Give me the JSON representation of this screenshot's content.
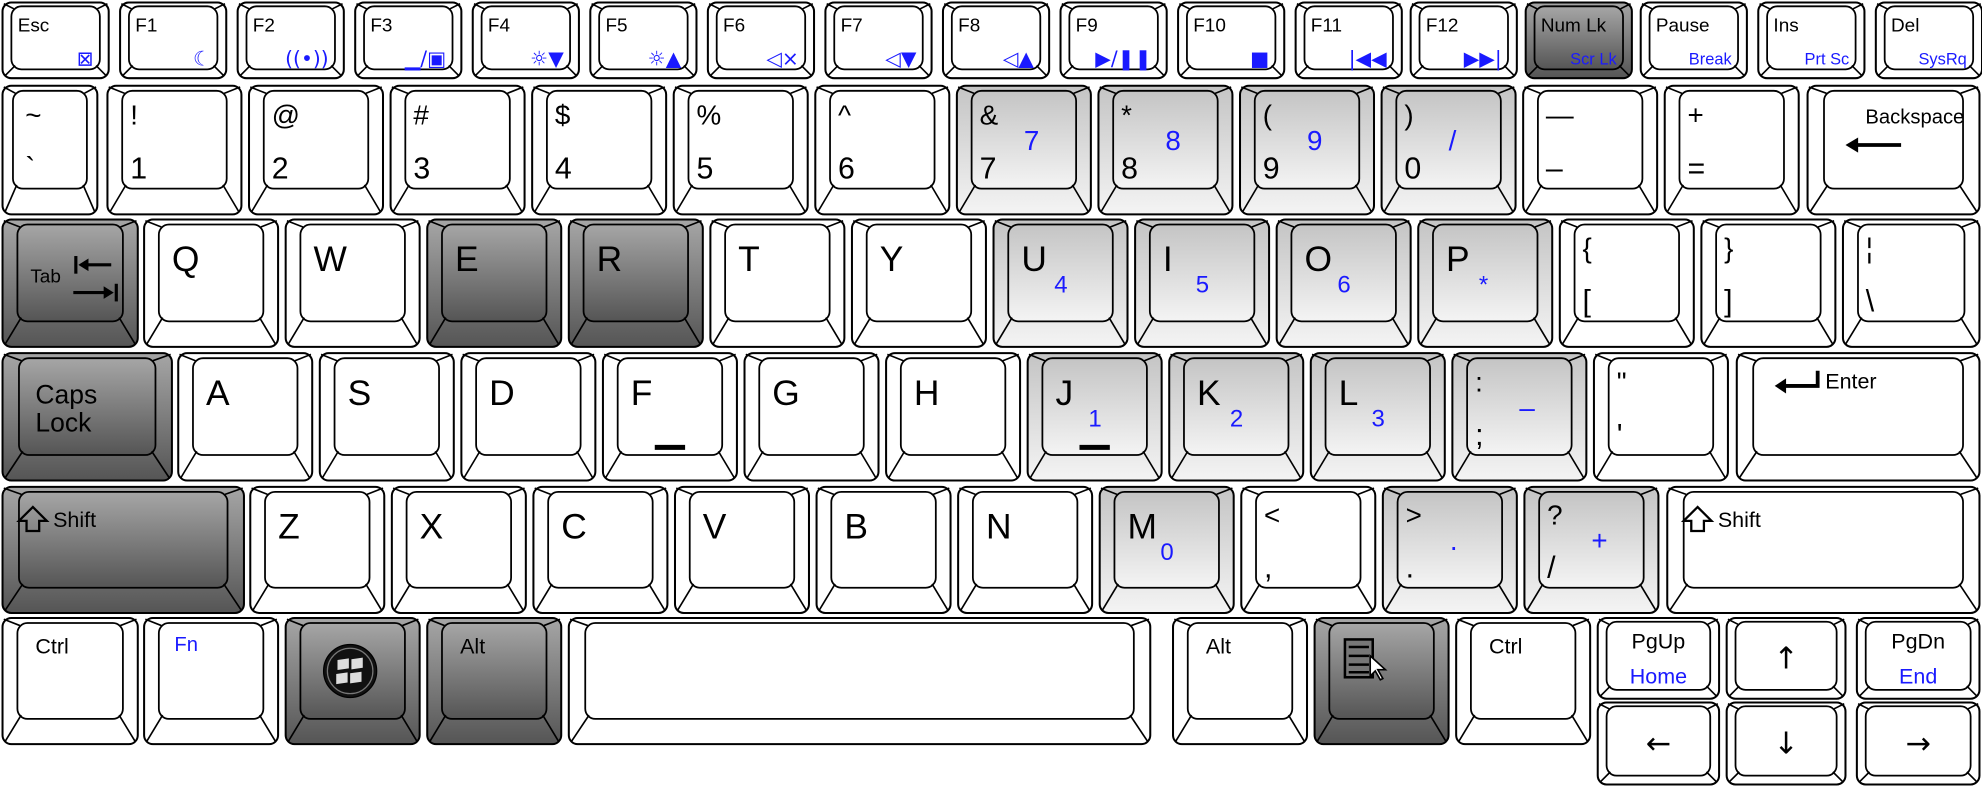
{
  "colors": {
    "blue_legend": "#1a1aff",
    "key_outline": "#000000",
    "dark_key_top": "#a6a6a6",
    "dark_key_bottom": "#555555",
    "light_key_top": "#c4c4c4",
    "light_key_bottom": "#f4f4f4",
    "white_key": "#ffffff"
  },
  "rows": [
    {
      "keys": [
        {
          "label": "Esc",
          "icon": "touchpad-off-icon"
        },
        {
          "label": "F1",
          "icon": "sleep-moon-icon"
        },
        {
          "label": "F2",
          "icon": "wireless-icon"
        },
        {
          "label": "F3",
          "icon": "display-toggle-icon"
        },
        {
          "label": "F4",
          "icon": "brightness-down-icon"
        },
        {
          "label": "F5",
          "icon": "brightness-up-icon"
        },
        {
          "label": "F6",
          "icon": "mute-icon"
        },
        {
          "label": "F7",
          "icon": "volume-down-icon"
        },
        {
          "label": "F8",
          "icon": "volume-up-icon"
        },
        {
          "label": "F9",
          "icon": "play-pause-icon"
        },
        {
          "label": "F10",
          "icon": "stop-icon"
        },
        {
          "label": "F11",
          "icon": "previous-track-icon"
        },
        {
          "label": "F12",
          "icon": "next-track-icon"
        },
        {
          "label": "Num Lk",
          "fn": "Scr Lk",
          "shade": "dark"
        },
        {
          "label": "Pause",
          "fn": "Break"
        },
        {
          "label": "Ins",
          "fn": "Prt Sc"
        },
        {
          "label": "Del",
          "fn": "SysRq"
        }
      ]
    },
    {
      "keys": [
        {
          "shift": "~",
          "label": "`"
        },
        {
          "shift": "!",
          "label": "1"
        },
        {
          "shift": "@",
          "label": "2"
        },
        {
          "shift": "#",
          "label": "3"
        },
        {
          "shift": "$",
          "label": "4"
        },
        {
          "shift": "%",
          "label": "5"
        },
        {
          "shift": "^",
          "label": "6"
        },
        {
          "shift": "&",
          "label": "7",
          "fn": "7",
          "shade": "light"
        },
        {
          "shift": "*",
          "label": "8",
          "fn": "8",
          "shade": "light"
        },
        {
          "shift": "(",
          "label": "9",
          "fn": "9",
          "shade": "light"
        },
        {
          "shift": ")",
          "label": "0",
          "fn": "/",
          "shade": "light"
        },
        {
          "shift": "—",
          "label": "–"
        },
        {
          "shift": "+",
          "label": "="
        },
        {
          "label": "Backspace",
          "icon": "backspace-arrow-icon"
        }
      ]
    },
    {
      "keys": [
        {
          "label": "Tab",
          "icon": "tab-arrows-icon",
          "shade": "dark"
        },
        {
          "label": "Q"
        },
        {
          "label": "W"
        },
        {
          "label": "E",
          "shade": "dark"
        },
        {
          "label": "R",
          "shade": "dark"
        },
        {
          "label": "T"
        },
        {
          "label": "Y"
        },
        {
          "label": "U",
          "fn": "4",
          "shade": "light"
        },
        {
          "label": "I",
          "fn": "5",
          "shade": "light"
        },
        {
          "label": "O",
          "fn": "6",
          "shade": "light"
        },
        {
          "label": "P",
          "fn": "*",
          "shade": "light"
        },
        {
          "shift": "{",
          "label": "["
        },
        {
          "shift": "}",
          "label": "]"
        },
        {
          "shift": "¦",
          "label": "\\"
        }
      ]
    },
    {
      "keys": [
        {
          "label": [
            "Caps",
            "Lock"
          ],
          "shade": "dark"
        },
        {
          "label": "A"
        },
        {
          "label": "S"
        },
        {
          "label": "D"
        },
        {
          "label": "F",
          "bump": true
        },
        {
          "label": "G"
        },
        {
          "label": "H"
        },
        {
          "label": "J",
          "fn": "1",
          "bump": true,
          "shade": "light"
        },
        {
          "label": "K",
          "fn": "2",
          "shade": "light"
        },
        {
          "label": "L",
          "fn": "3",
          "shade": "light"
        },
        {
          "shift": ":",
          "label": ";",
          "fn": "–",
          "shade": "light"
        },
        {
          "shift": "\"",
          "label": "'"
        },
        {
          "label": "Enter",
          "icon": "enter-arrow-icon"
        }
      ]
    },
    {
      "keys": [
        {
          "label": "Shift",
          "icon": "shift-arrow-icon",
          "shade": "dark"
        },
        {
          "label": "Z"
        },
        {
          "label": "X"
        },
        {
          "label": "C"
        },
        {
          "label": "V"
        },
        {
          "label": "B"
        },
        {
          "label": "N"
        },
        {
          "label": "M",
          "fn": "0",
          "shade": "light"
        },
        {
          "shift": "<",
          "label": ","
        },
        {
          "shift": ">",
          "label": ".",
          "fn": ".",
          "shade": "light"
        },
        {
          "shift": "?",
          "label": "/",
          "fn": "+",
          "shade": "light"
        },
        {
          "label": "Shift",
          "icon": "shift-arrow-icon"
        }
      ]
    },
    {
      "keys": [
        {
          "label": "Ctrl"
        },
        {
          "fn": "Fn"
        },
        {
          "icon": "windows-logo-icon",
          "shade": "dark"
        },
        {
          "label": "Alt",
          "shade": "dark"
        },
        {
          "label": ""
        },
        {
          "label": "Alt"
        },
        {
          "icon": "context-menu-icon",
          "shade": "dark"
        },
        {
          "label": "Ctrl"
        },
        {
          "label": "PgUp",
          "fn": "Home"
        },
        {
          "icon": "arrow-up-icon"
        },
        {
          "label": "PgDn",
          "fn": "End"
        },
        {
          "icon": "arrow-left-icon"
        },
        {
          "icon": "arrow-down-icon"
        },
        {
          "icon": "arrow-right-icon"
        }
      ]
    }
  ]
}
